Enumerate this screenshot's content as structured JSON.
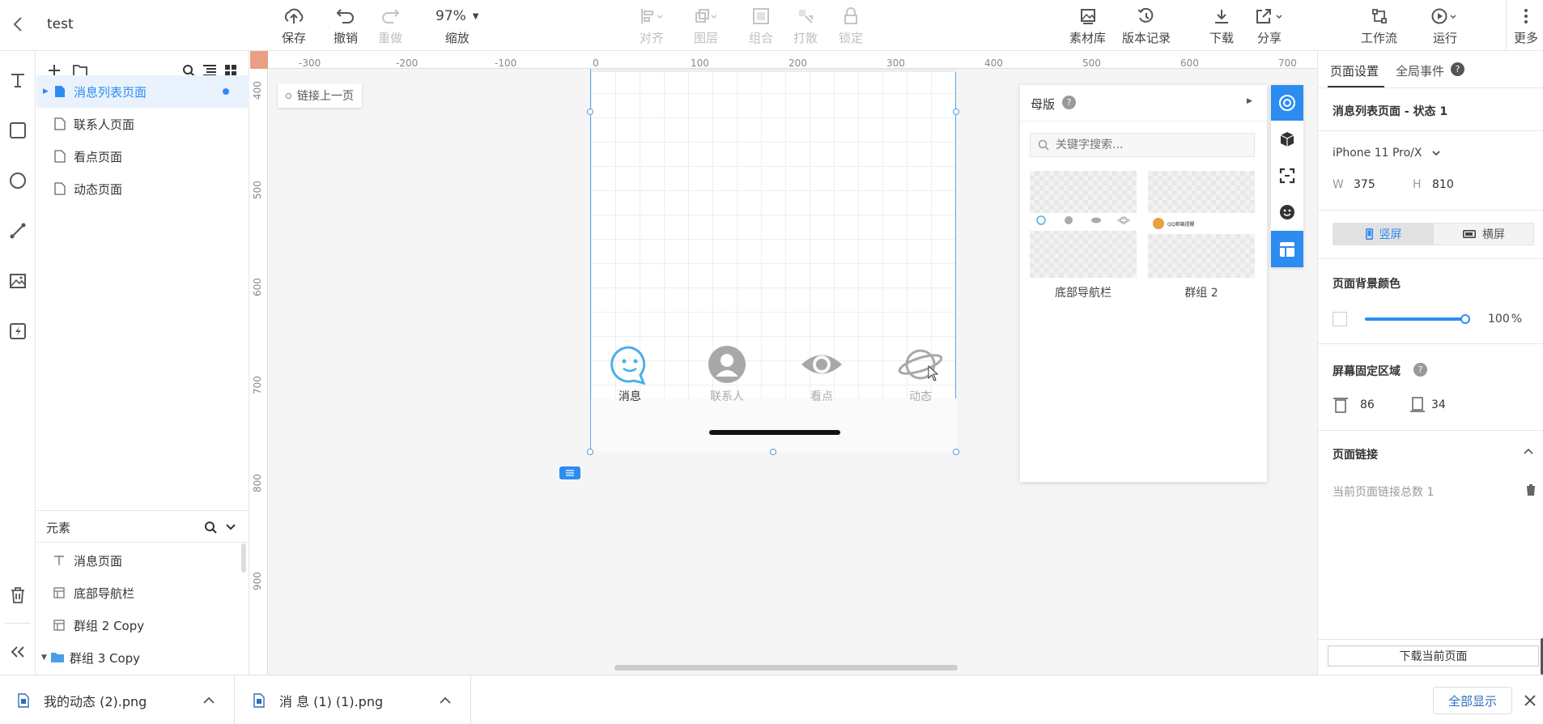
{
  "project": {
    "back_icon": "chevron-left-icon",
    "name": "test"
  },
  "toolbar": {
    "save": "保存",
    "undo": "撤销",
    "redo": "重做",
    "zoom_value": "97%",
    "zoom": "缩放",
    "align": "对齐",
    "layer": "图层",
    "group": "组合",
    "ungroup": "打散",
    "lock": "锁定",
    "assets": "素材库",
    "versions": "版本记录",
    "download": "下载",
    "share": "分享",
    "workflow": "工作流",
    "run": "运行",
    "more": "更多"
  },
  "pages": {
    "items": [
      {
        "label": "消息列表页面",
        "active": true
      },
      {
        "label": "联系人页面",
        "active": false
      },
      {
        "label": "看点页面",
        "active": false
      },
      {
        "label": "动态页面",
        "active": false
      }
    ]
  },
  "elements": {
    "title": "元素",
    "items": [
      {
        "label": "消息页面",
        "icon": "text-icon"
      },
      {
        "label": "底部导航栏",
        "icon": "layout-icon"
      },
      {
        "label": "群组 2 Copy",
        "icon": "layout-icon"
      },
      {
        "label": "群组 3 Copy",
        "icon": "folder-icon"
      }
    ]
  },
  "canvas": {
    "ruler_h": [
      "-300",
      "-200",
      "-100",
      "0",
      "100",
      "200",
      "300",
      "400",
      "500",
      "600",
      "700"
    ],
    "ruler_v": [
      "400",
      "500",
      "600",
      "700",
      "800",
      "900"
    ],
    "link_prev": "链接上一页",
    "tabbar": [
      {
        "label": "消息",
        "icon": "chat-bubble-icon",
        "active": true
      },
      {
        "label": "联系人",
        "icon": "person-icon",
        "active": false
      },
      {
        "label": "看点",
        "icon": "eye-icon",
        "active": false
      },
      {
        "label": "动态",
        "icon": "planet-icon",
        "active": false
      }
    ]
  },
  "master_panel": {
    "title": "母版",
    "search_placeholder": "关键字搜索...",
    "items": [
      {
        "label": "底部导航栏"
      },
      {
        "label": "群组 2",
        "preview_text": "QQ邮箱提醒"
      }
    ]
  },
  "right_panel": {
    "tab_page": "页面设置",
    "tab_global": "全局事件",
    "state_title": "消息列表页面 - 状态 1",
    "device": "iPhone 11 Pro/X",
    "w_label": "W",
    "w_value": "375",
    "h_label": "H",
    "h_value": "810",
    "portrait": "竖屏",
    "landscape": "横屏",
    "bg_color_title": "页面背景颜色",
    "opacity": "100",
    "opacity_unit": "%",
    "fixed_area_title": "屏幕固定区域",
    "fixed_top": "86",
    "fixed_bottom": "34",
    "page_link_title": "页面链接",
    "link_count": "当前页面链接总数  1",
    "download_page": "下载当前页面"
  },
  "downloads": {
    "items": [
      {
        "name": "我的动态 (2).png"
      },
      {
        "name": "消 息 (1) (1).png"
      }
    ],
    "show_all": "全部显示"
  },
  "colors": {
    "accent": "#2d8cf0",
    "tab_active": "#4ab0ea",
    "tab_inactive": "#aaaaaa"
  }
}
